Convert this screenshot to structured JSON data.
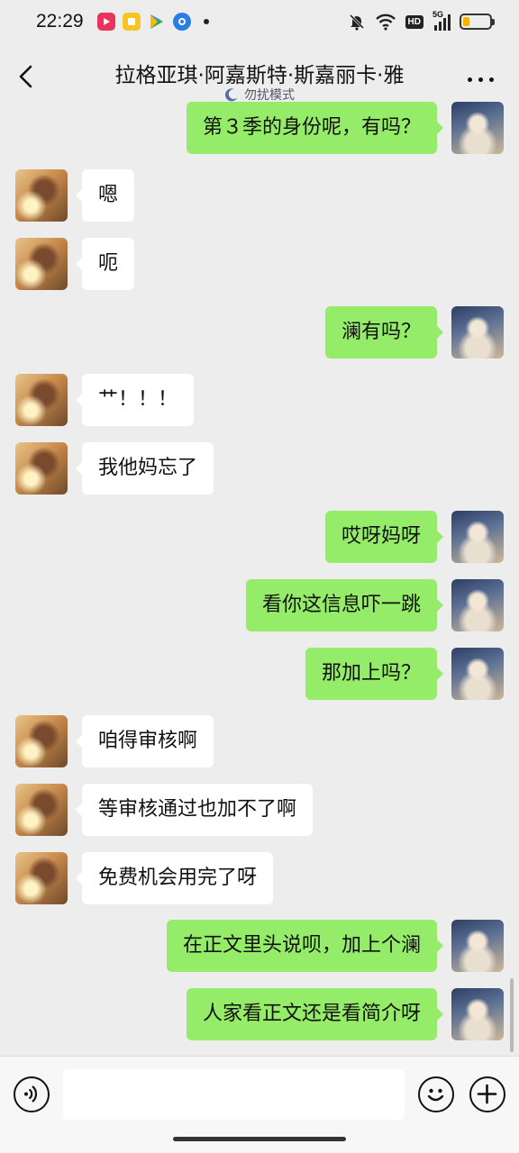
{
  "status_bar": {
    "time": "22:29",
    "app_icons": [
      {
        "name": "video-app-icon",
        "color": "#e8345a"
      },
      {
        "name": "notes-app-icon",
        "color": "#f7c325"
      },
      {
        "name": "play-store-icon",
        "color": "#34a853"
      },
      {
        "name": "browser-app-icon",
        "color": "#2a7de1"
      }
    ],
    "network_label": "5G",
    "hd_label": "HD",
    "battery_level": 0.25
  },
  "header": {
    "title": "拉格亚琪·阿嘉斯特·斯嘉丽卡·雅",
    "subtitle": "勿扰模式"
  },
  "messages": [
    {
      "side": "right",
      "text": "第３季的身份呢，有吗？"
    },
    {
      "side": "left",
      "text": "嗯"
    },
    {
      "side": "left",
      "text": "呃"
    },
    {
      "side": "right",
      "text": "澜有吗？"
    },
    {
      "side": "left",
      "text": "艹！！！"
    },
    {
      "side": "left",
      "text": "我他妈忘了"
    },
    {
      "side": "right",
      "text": "哎呀妈呀"
    },
    {
      "side": "right",
      "text": "看你这信息吓一跳"
    },
    {
      "side": "right",
      "text": "那加上吗？"
    },
    {
      "side": "left",
      "text": "咱得审核啊"
    },
    {
      "side": "left",
      "text": "等审核通过也加不了啊"
    },
    {
      "side": "left",
      "text": "免费机会用完了呀"
    },
    {
      "side": "right",
      "text": "在正文里头说呗，加上个澜"
    },
    {
      "side": "right",
      "text": "人家看正文还是看简介呀"
    }
  ],
  "input": {
    "value": "",
    "placeholder": ""
  },
  "colors": {
    "sent_bubble": "#95ec69",
    "received_bubble": "#ffffff",
    "background": "#ededed"
  }
}
